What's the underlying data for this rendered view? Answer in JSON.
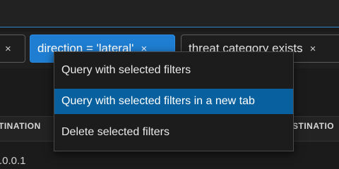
{
  "filters": [
    {
      "label": "",
      "close": "×"
    },
    {
      "label": "direction = 'lateral'",
      "close": "×",
      "selected": true
    },
    {
      "label": "threat category exists",
      "close": "×"
    }
  ],
  "table": {
    "header_left": "TINATION",
    "header_right": "STINATIO",
    "first_cell": ".0.0.1"
  },
  "context_menu": {
    "items": [
      "Query with selected filters",
      "Query with selected filters in a new tab",
      "Delete selected filters"
    ],
    "highlighted_index": 1
  },
  "colors": {
    "selected_chip": "#1f7ed1",
    "menu_highlight": "#08609e",
    "accent_line": "#2f86c9"
  }
}
